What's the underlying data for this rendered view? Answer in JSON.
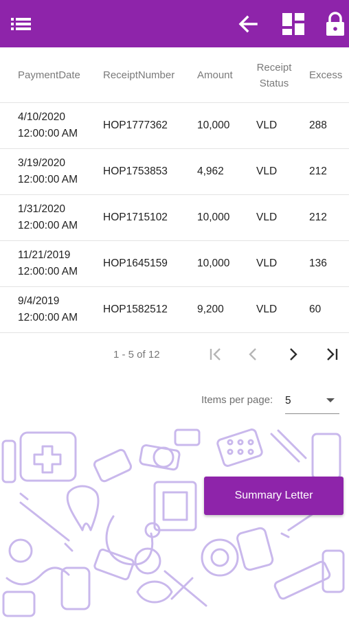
{
  "colors": {
    "accent": "#8e24aa",
    "status_ok": "#2aa33a",
    "pattern": "#c9b8ec"
  },
  "appbar": {
    "menu_icon": "menu-list-icon",
    "back_icon": "arrow-back-icon",
    "dashboard_icon": "dashboard-icon",
    "lock_icon": "lock-icon"
  },
  "table": {
    "headers": {
      "payment_date": "PaymentDate",
      "receipt_number": "ReceiptNumber",
      "amount": "Amount",
      "receipt_status_1": "Receipt",
      "receipt_status_2": "Status",
      "excess": "Excess"
    },
    "rows": [
      {
        "date": "4/10/2020",
        "time": "12:00:00 AM",
        "receipt": "HOP1777362",
        "amount": "10,000",
        "status": "VLD",
        "excess": "288"
      },
      {
        "date": "3/19/2020",
        "time": "12:00:00 AM",
        "receipt": "HOP1753853",
        "amount": "4,962",
        "status": "VLD",
        "excess": "212"
      },
      {
        "date": "1/31/2020",
        "time": "12:00:00 AM",
        "receipt": "HOP1715102",
        "amount": "10,000",
        "status": "VLD",
        "excess": "212"
      },
      {
        "date": "11/21/2019",
        "time": "12:00:00 AM",
        "receipt": "HOP1645159",
        "amount": "10,000",
        "status": "VLD",
        "excess": "136"
      },
      {
        "date": "9/4/2019",
        "time": "12:00:00 AM",
        "receipt": "HOP1582512",
        "amount": "9,200",
        "status": "VLD",
        "excess": "60"
      }
    ]
  },
  "paginator": {
    "range_label": "1 - 5 of 12",
    "items_per_page_label": "Items per page:",
    "items_per_page_value": "5",
    "first_icon": "first-page-icon",
    "prev_icon": "chevron-left-icon",
    "next_icon": "chevron-right-icon",
    "last_icon": "last-page-icon"
  },
  "actions": {
    "summary_letter": "Summary Letter"
  },
  "background": {
    "pattern_icon": "medical-doodle-pattern"
  }
}
